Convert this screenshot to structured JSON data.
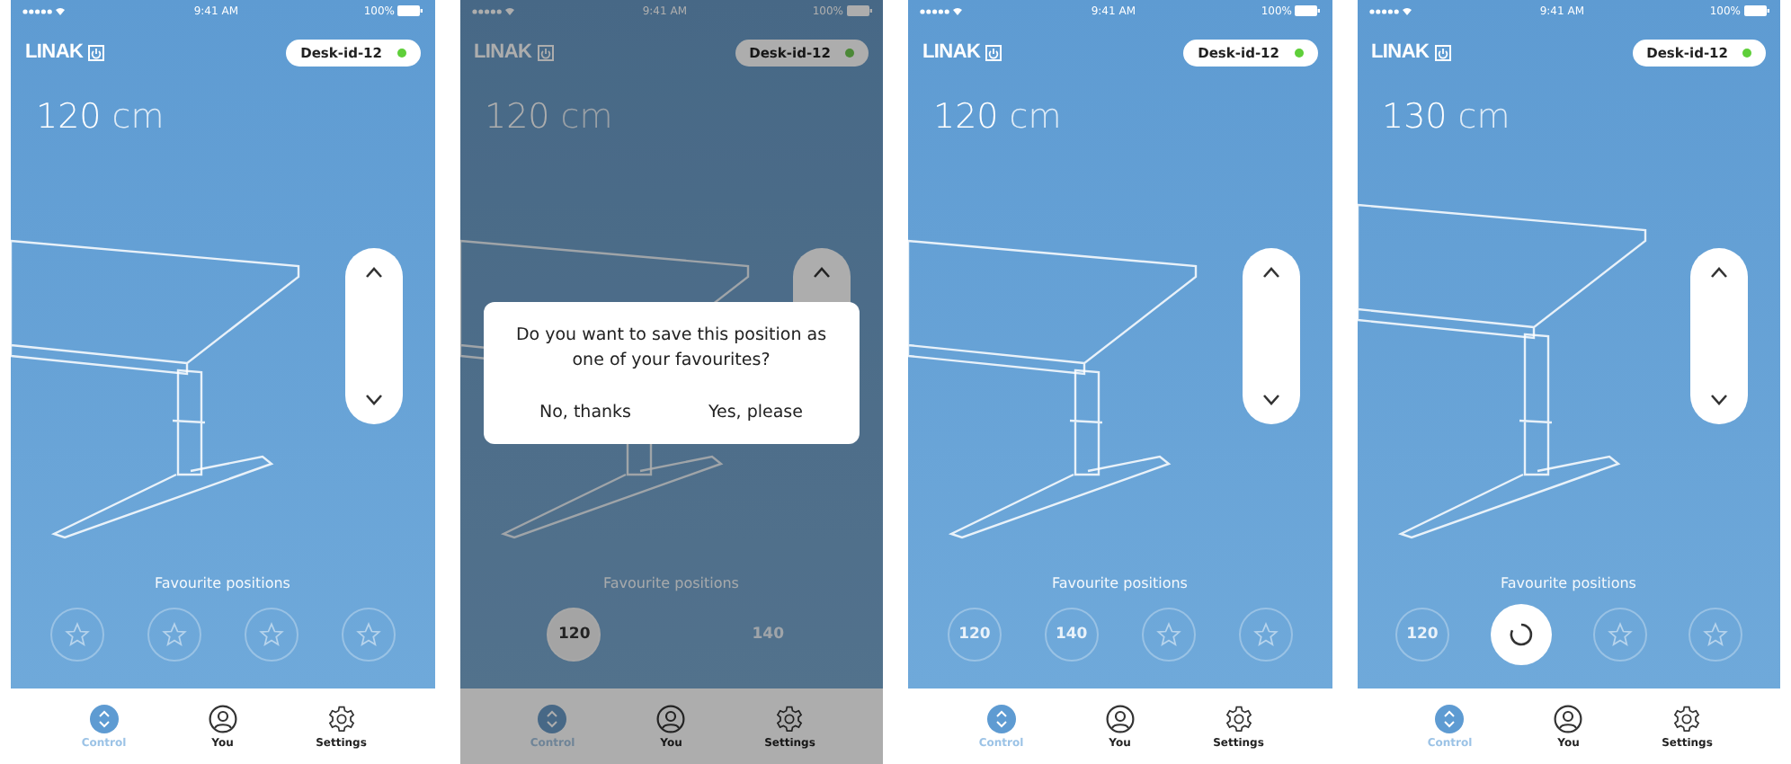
{
  "screens": [
    {
      "status": {
        "time": "9:41 AM",
        "battery": "100%"
      },
      "brand": "LINAK",
      "device": {
        "name": "Desk-id-12",
        "connected": true
      },
      "height": {
        "value": "120",
        "unit": "cm"
      },
      "dimmed": false,
      "favourites_label": "Favourite positions",
      "favourites": [
        {
          "kind": "empty"
        },
        {
          "kind": "empty"
        },
        {
          "kind": "empty"
        },
        {
          "kind": "empty"
        }
      ],
      "tabs": [
        {
          "label": "Control",
          "selected": true
        },
        {
          "label": "You",
          "selected": false
        },
        {
          "label": "Settings",
          "selected": false
        }
      ]
    },
    {
      "status": {
        "time": "9:41 AM",
        "battery": "100%"
      },
      "brand": "LINAK",
      "device": {
        "name": "Desk-id-12",
        "connected": true
      },
      "height": {
        "value": "120",
        "unit": "cm"
      },
      "dimmed": true,
      "dialog": {
        "message": "Do you want to save this position as one of your favourites?",
        "buttons": [
          "No, thanks",
          "Yes, please"
        ]
      },
      "favourites_label": "Favourite positions",
      "favourites": [
        {
          "kind": "value",
          "label": "120",
          "selected": true
        },
        {
          "kind": "plain",
          "label": "140"
        }
      ],
      "tabs": [
        {
          "label": "Control",
          "selected": true
        },
        {
          "label": "You",
          "selected": false
        },
        {
          "label": "Settings",
          "selected": false
        }
      ]
    },
    {
      "status": {
        "time": "9:41 AM",
        "battery": "100%"
      },
      "brand": "LINAK",
      "device": {
        "name": "Desk-id-12",
        "connected": true
      },
      "height": {
        "value": "120",
        "unit": "cm"
      },
      "dimmed": false,
      "favourites_label": "Favourite positions",
      "favourites": [
        {
          "kind": "value",
          "label": "120",
          "selected": false
        },
        {
          "kind": "value",
          "label": "140",
          "selected": false
        },
        {
          "kind": "empty"
        },
        {
          "kind": "empty"
        }
      ],
      "tabs": [
        {
          "label": "Control",
          "selected": true
        },
        {
          "label": "You",
          "selected": false
        },
        {
          "label": "Settings",
          "selected": false
        }
      ]
    },
    {
      "status": {
        "time": "9:41 AM",
        "battery": "100%"
      },
      "brand": "LINAK",
      "device": {
        "name": "Desk-id-12",
        "connected": true
      },
      "height": {
        "value": "130",
        "unit": "cm"
      },
      "dimmed": false,
      "favourites_label": "Favourite positions",
      "favourites": [
        {
          "kind": "value",
          "label": "120",
          "selected": false
        },
        {
          "kind": "loading"
        },
        {
          "kind": "empty"
        },
        {
          "kind": "empty"
        }
      ],
      "tabs": [
        {
          "label": "Control",
          "selected": true
        },
        {
          "label": "You",
          "selected": false
        },
        {
          "label": "Settings",
          "selected": false
        }
      ]
    }
  ]
}
